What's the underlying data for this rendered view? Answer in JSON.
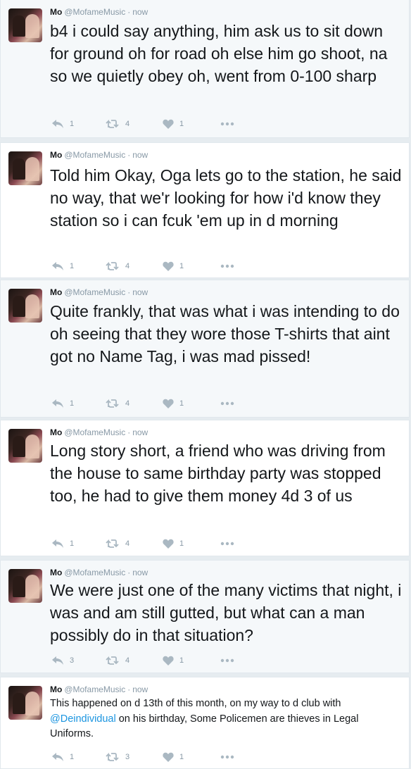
{
  "tweets": [
    {
      "name": "Mo",
      "handle": "@MofameMusic",
      "time": "now",
      "text": "b4 i could say anything, him ask us to sit down for ground oh for road oh else him go shoot, na so we quietly obey oh, went from 0-100 sharp",
      "replies": "1",
      "retweets": "4",
      "likes": "1"
    },
    {
      "name": "Mo",
      "handle": "@MofameMusic",
      "time": "now",
      "text": "Told him Okay, Oga lets go to the station, he said no way, that we'r looking for how i'd know they station so i can fcuk 'em up in d morning",
      "replies": "1",
      "retweets": "4",
      "likes": "1"
    },
    {
      "name": "Mo",
      "handle": "@MofameMusic",
      "time": "now",
      "text": "Quite frankly, that was what i was intending to do oh seeing that they wore those T-shirts that aint got no Name Tag, i was mad pissed!",
      "replies": "1",
      "retweets": "4",
      "likes": "1"
    },
    {
      "name": "Mo",
      "handle": "@MofameMusic",
      "time": "now",
      "text": "Long story short, a friend who was driving from the house to same birthday party was stopped too, he had to give them money 4d 3 of us",
      "replies": "1",
      "retweets": "4",
      "likes": "1"
    },
    {
      "name": "Mo",
      "handle": "@MofameMusic",
      "time": "now",
      "text": "We were just one of the many victims that night, i was and am still gutted, but what can a man possibly do in that situation?",
      "replies": "3",
      "retweets": "4",
      "likes": "1"
    },
    {
      "name": "Mo",
      "handle": "@MofameMusic",
      "time": "now",
      "text_before": "This happened on d 13th of this month, on my way to d club with ",
      "mention": "@Deindividual",
      "text_after": " on his birthday, Some Policemen are thieves in Legal Uniforms.",
      "replies": "1",
      "retweets": "3",
      "likes": "1"
    }
  ],
  "icons": {
    "reply": "reply-icon",
    "retweet": "retweet-icon",
    "like": "heart-icon",
    "more": "more-icon"
  },
  "colors": {
    "text": "#14171a",
    "meta": "#8899a6",
    "mention": "#1b95e0",
    "selected_bg": "#f5f8fa"
  }
}
